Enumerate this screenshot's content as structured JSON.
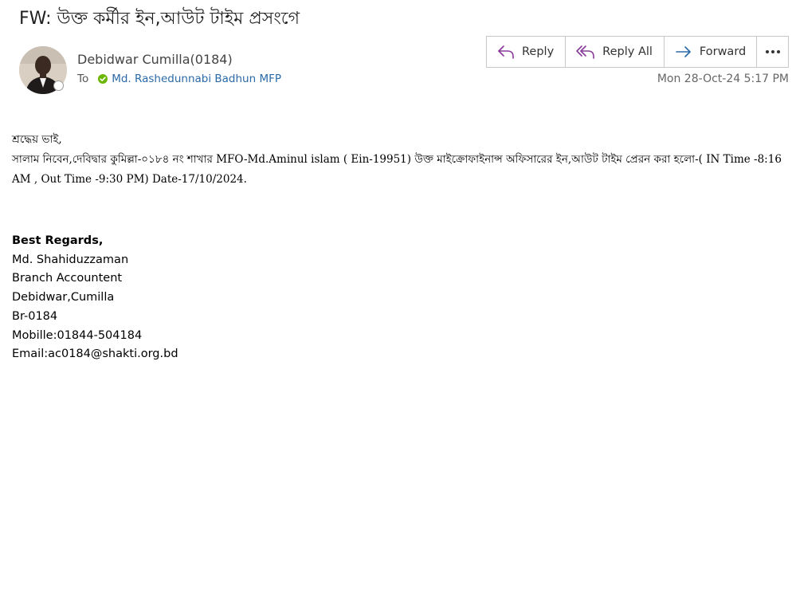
{
  "email": {
    "subject": "FW: উক্ত কর্মীর ইন,আউট টাইম প্রসংগে",
    "sender": "Debidwar Cumilla(0184)",
    "to_label": "To",
    "recipient": "Md. Rashedunnabi Badhun MFP",
    "date": "Mon 28-Oct-24 5:17 PM"
  },
  "actions": {
    "reply": "Reply",
    "reply_all": "Reply All",
    "forward": "Forward",
    "more_icon": "more-icon"
  },
  "body": {
    "salutation": "শ্রদ্ধেয় ভাই,",
    "paragraph": "সালাম নিবেন,দেবিদ্বার কুমিল্লা-০১৮৪ নং শাখার MFO-Md.Aminul islam ( Ein-19951) উক্ত মাইক্রোফাইনান্স অফিসারের ইন,আউট টাইম  প্রেরন করা হলো-( IN Time -8:16 AM , Out Time -9:30 PM) Date-17/10/2024."
  },
  "signature": {
    "regards": "Best Regards,",
    "name": "Md. Shahiduzzaman",
    "title": "Branch Accountent",
    "location": "Debidwar,Cumilla",
    "branch": "Br-0184",
    "mobile": "Mobille:01844-504184",
    "email": "Email:ac0184@shakti.org.bd"
  },
  "colors": {
    "accent": "#2b6aa8",
    "reply_icon": "#8a3a9a",
    "forward_icon": "#2b6aa8",
    "presence_ok": "#6bb700"
  }
}
